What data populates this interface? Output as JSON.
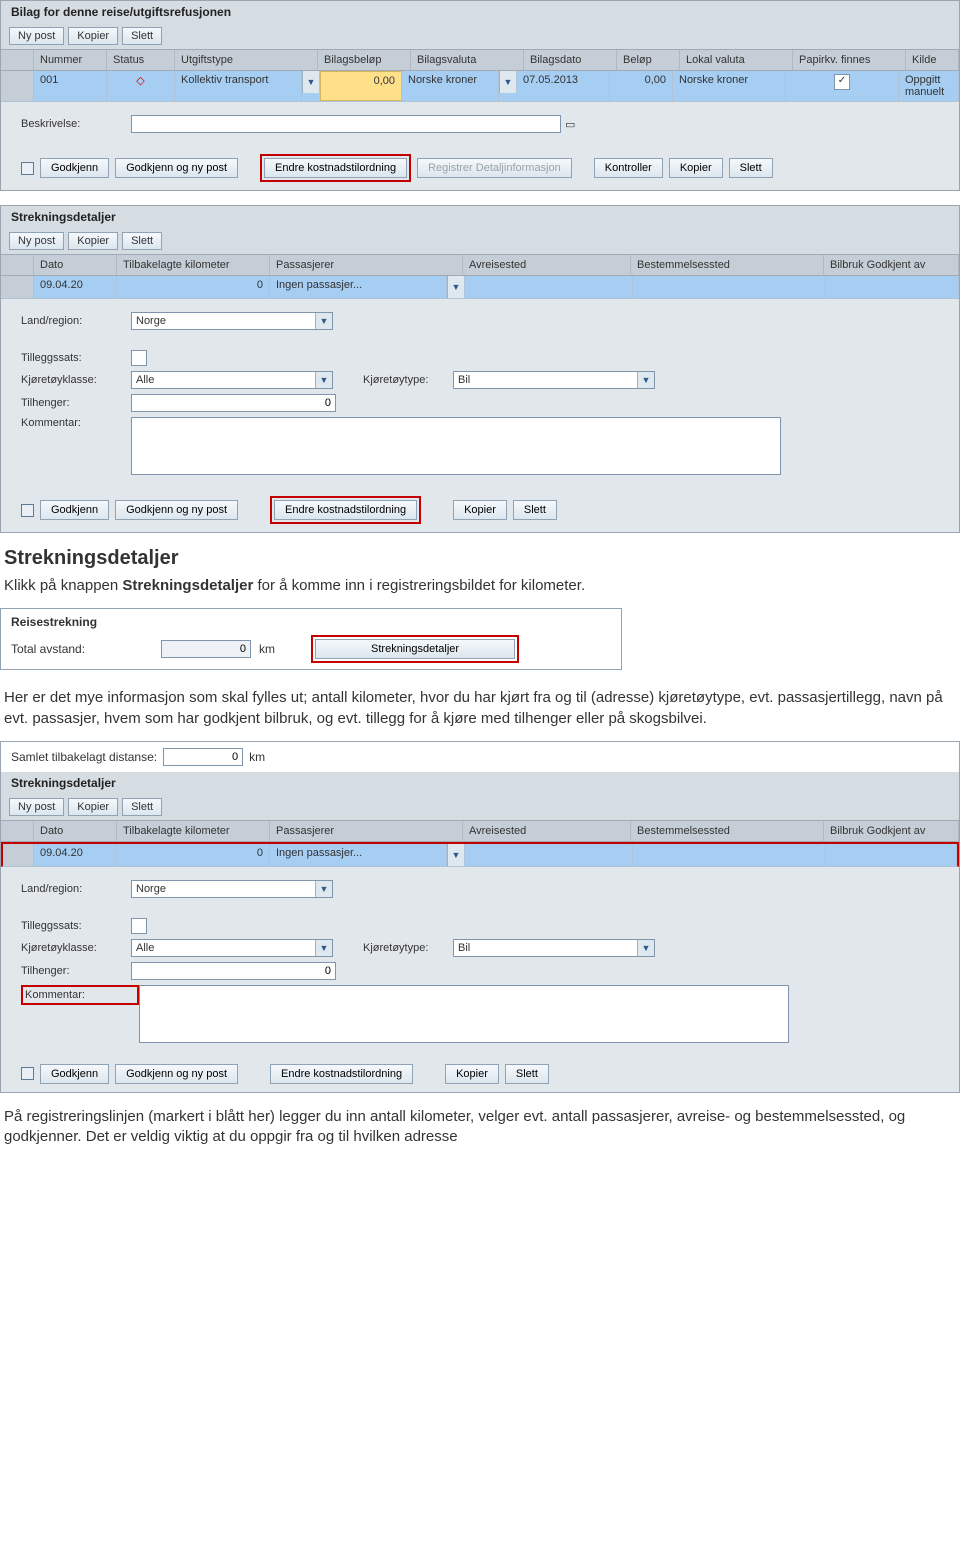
{
  "panel1": {
    "title": "Bilag for denne reise/utgiftsrefusjonen",
    "buttons": {
      "ny": "Ny post",
      "kopier": "Kopier",
      "slett": "Slett"
    },
    "columns": {
      "nummer": "Nummer",
      "status": "Status",
      "utgiftstype": "Utgiftstype",
      "bilagsbelop": "Bilagsbeløp",
      "bilagsvaluta": "Bilagsvaluta",
      "bilagsdato": "Bilagsdato",
      "belop": "Beløp",
      "lokal": "Lokal valuta",
      "papirkv": "Papirkv. finnes",
      "kilde": "Kilde"
    },
    "row": {
      "nummer": "001",
      "status": "◇",
      "utgiftstype": "Kollektiv transport",
      "bilagsbelop": "0,00",
      "bilagsvaluta": "Norske kroner",
      "bilagsdato": "07.05.2013",
      "belop": "0,00",
      "lokal": "Norske kroner",
      "papirkv": "✓",
      "kilde": "Oppgitt manuelt"
    },
    "beskrivelse_label": "Beskrivelse:",
    "actions": {
      "godkjenn": "Godkjenn",
      "ny": "Godkjenn og ny post",
      "endre": "Endre kostnadstilordning",
      "registrer": "Registrer Detaljinformasjon",
      "kontroller": "Kontroller",
      "kopier": "Kopier",
      "slett": "Slett"
    }
  },
  "panel2": {
    "title": "Strekningsdetaljer",
    "buttons": {
      "ny": "Ny post",
      "kopier": "Kopier",
      "slett": "Slett"
    },
    "columns": {
      "dato": "Dato",
      "km": "Tilbakelagte kilometer",
      "pass": "Passasjerer",
      "avreise": "Avreisested",
      "best": "Bestemmelsessted",
      "bilbruk": "Bilbruk Godkjent av"
    },
    "row": {
      "dato": "09.04.20",
      "km": "0",
      "pass": "Ingen passasjer..."
    },
    "labels": {
      "land": "Land/region:",
      "tillegg": "Tilleggssats:",
      "klasse": "Kjøretøyklasse:",
      "type": "Kjøretøytype:",
      "tilhenger": "Tilhenger:",
      "kommentar": "Kommentar:"
    },
    "values": {
      "land": "Norge",
      "klasse": "Alle",
      "type": "Bil",
      "tilhenger": "0"
    },
    "actions": {
      "godkjenn": "Godkjenn",
      "ny": "Godkjenn og ny post",
      "endre": "Endre kostnadstilordning",
      "kopier": "Kopier",
      "slett": "Slett"
    }
  },
  "doc": {
    "heading": "Strekningsdetaljer",
    "p1a": "Klikk på knappen ",
    "p1b": "Strekningsdetaljer",
    "p1c": " for å komme inn i registreringsbildet for kilometer.",
    "p2": "Her er det mye informasjon som skal fylles ut; antall kilometer, hvor du har kjørt fra og til (adresse) kjøretøytype, evt. passasjertillegg, navn på evt. passasjer, hvem som har godkjent bilbruk, og evt. tillegg for å kjøre med tilhenger eller på skogsbilvei.",
    "p3": "På registreringslinjen (markert i blått her) legger du inn antall kilometer, velger evt. antall passasjerer, avreise- og bestemmelsessted, og godkjenner. Det er veldig viktig at du oppgir fra og til hvilken adresse"
  },
  "reise": {
    "title": "Reisestrekning",
    "label": "Total avstand:",
    "value": "0",
    "unit": "km",
    "button": "Strekningsdetaljer"
  },
  "panel3": {
    "samlet_label": "Samlet tilbakelagt distanse:",
    "samlet_value": "0",
    "samlet_unit": "km"
  }
}
